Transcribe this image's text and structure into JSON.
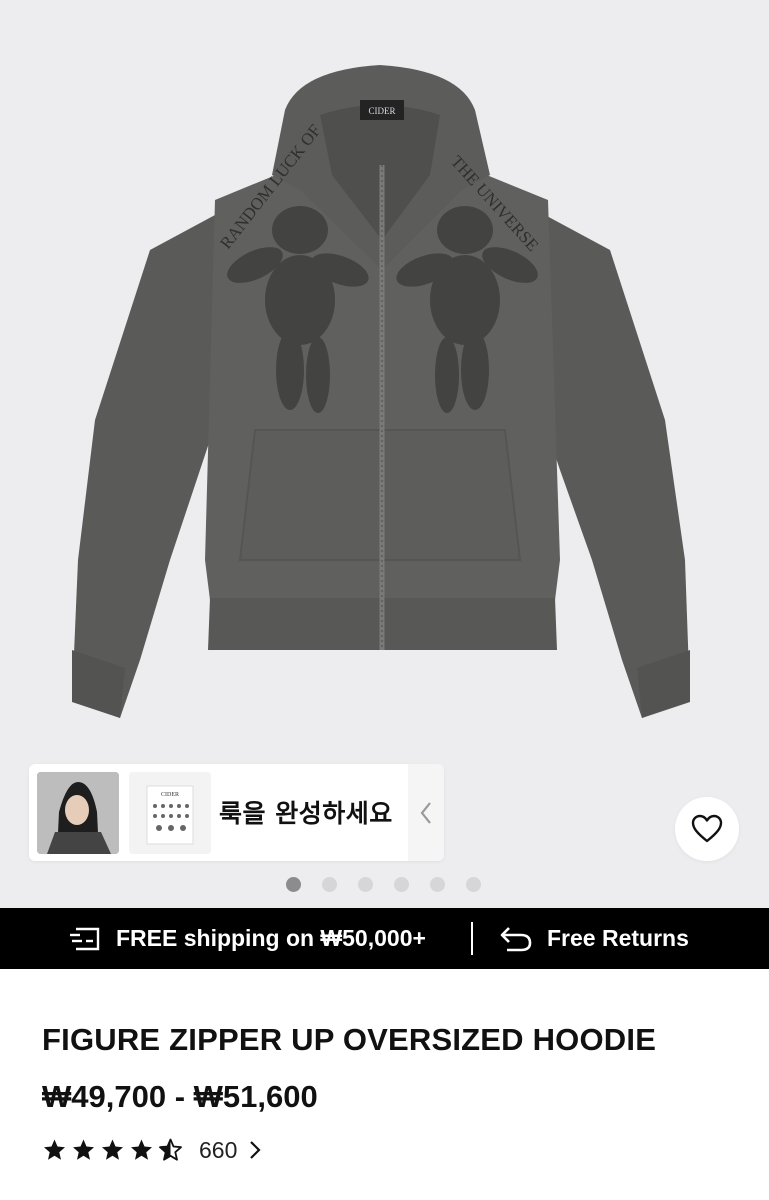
{
  "gallery": {
    "brand_tag": "CIDER",
    "print_text_left": "RANDOM LUCK OF",
    "print_text_right": "THE UNIVERSE",
    "thumb_tag": "CIDER",
    "active_slide": 1,
    "slide_count": 6
  },
  "look": {
    "text": "룩을 완성하세요"
  },
  "promo": {
    "shipping": "FREE shipping on ₩50,000+",
    "returns": "Free Returns"
  },
  "product": {
    "title": "FIGURE ZIPPER UP OVERSIZED HOODIE",
    "price": "₩49,700 - ₩51,600",
    "rating": 4.5,
    "review_count": "660"
  },
  "colors": {
    "hoodie": "#5f605e",
    "promo_bg": "#000000",
    "gallery_bg": "#ededef"
  },
  "icons": {
    "wishlist": "heart-icon",
    "shipping": "delivery-icon",
    "returns": "return-arrow-icon",
    "collapse": "chevron-left-icon",
    "reviews": "chevron-right-icon",
    "rating": "star-icon"
  }
}
